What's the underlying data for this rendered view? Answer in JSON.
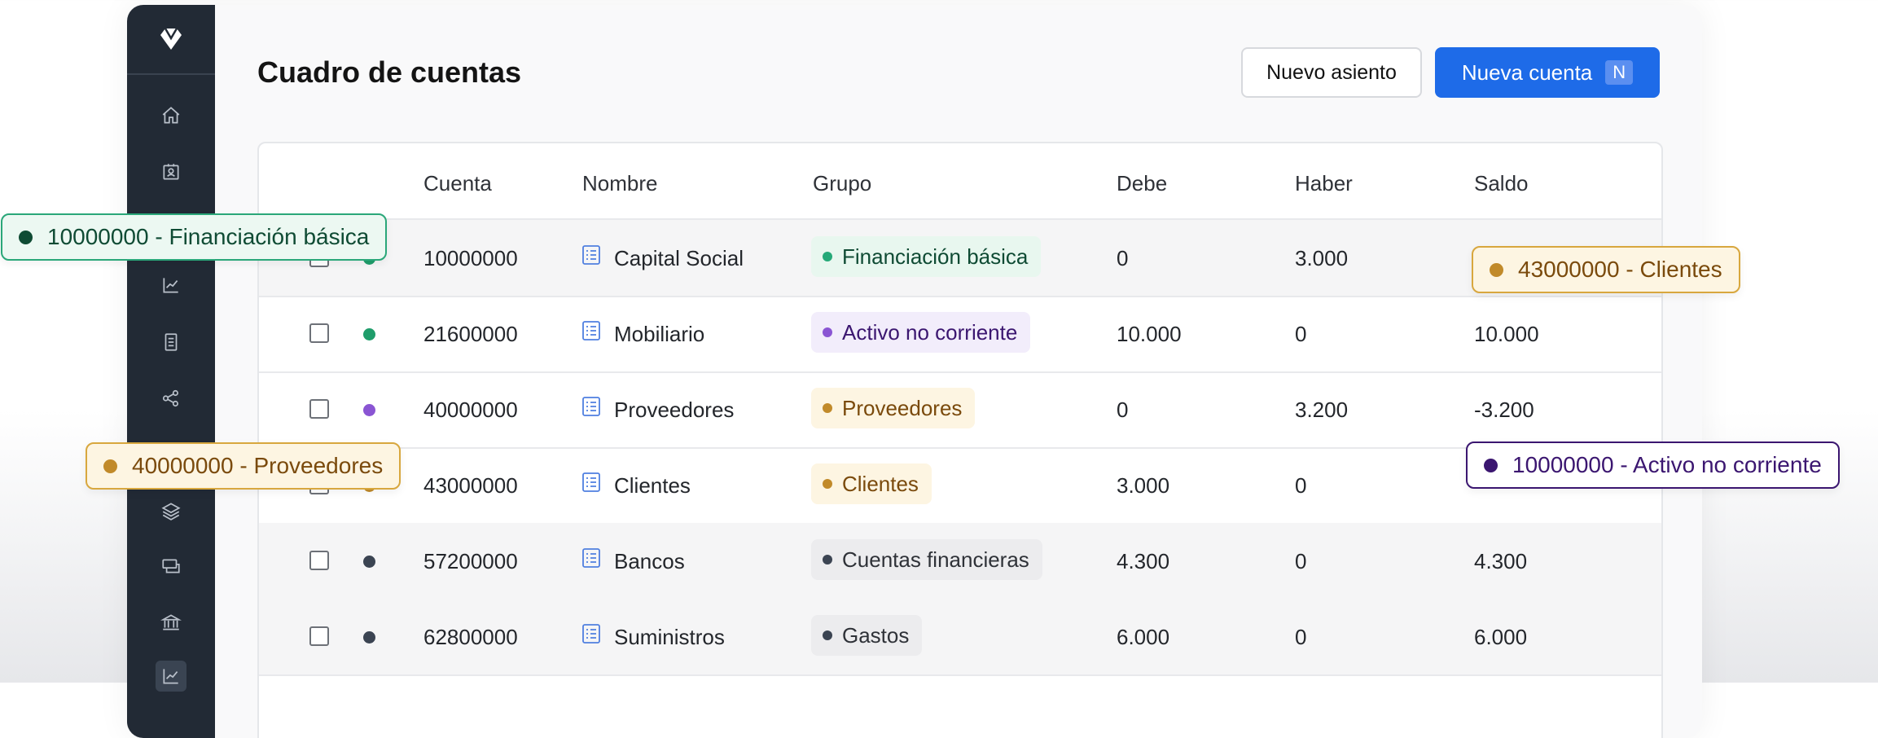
{
  "page": {
    "title": "Cuadro de cuentas"
  },
  "toolbar": {
    "secondary_label": "Nuevo asiento",
    "primary_label": "Nueva cuenta",
    "primary_shortcut": "N"
  },
  "sidebar": {
    "icons": [
      "home-icon",
      "contacts-icon",
      "reports-icon",
      "ledger-icon",
      "share-icon",
      "layers-icon",
      "payments-icon",
      "bank-icon",
      "analytics-icon"
    ],
    "active": "analytics-icon"
  },
  "table": {
    "columns": [
      "Cuenta",
      "Nombre",
      "Grupo",
      "Debe",
      "Haber",
      "Saldo"
    ],
    "rows": [
      {
        "cuenta": "10000000",
        "nombre": "Capital Social",
        "grupo": "Financiación básica",
        "debe": "0",
        "haber": "3.000",
        "saldo": "",
        "dot": "#1f9d6b",
        "pill_bg": "#e8f7ef",
        "pill_fg": "#0f4b34",
        "pill_dot": "#25a978"
      },
      {
        "cuenta": "21600000",
        "nombre": "Mobiliario",
        "grupo": "Activo no corriente",
        "debe": "10.000",
        "haber": "0",
        "saldo": "10.000",
        "dot": "#1f9d6b",
        "pill_bg": "#f2edfb",
        "pill_fg": "#3b1670",
        "pill_dot": "#8a55d3"
      },
      {
        "cuenta": "40000000",
        "nombre": "Proveedores",
        "grupo": "Proveedores",
        "debe": "0",
        "haber": "3.200",
        "saldo": "-3.200",
        "dot": "#8a55d3",
        "pill_bg": "#fdf5e2",
        "pill_fg": "#7a4a0c",
        "pill_dot": "#c18a2a"
      },
      {
        "cuenta": "43000000",
        "nombre": "Clientes",
        "grupo": "Clientes",
        "debe": "3.000",
        "haber": "0",
        "saldo": "",
        "dot": "#c18a2a",
        "pill_bg": "#fdf5e2",
        "pill_fg": "#7a4a0c",
        "pill_dot": "#c18a2a"
      },
      {
        "cuenta": "57200000",
        "nombre": "Bancos",
        "grupo": "Cuentas financieras",
        "debe": "4.300",
        "haber": "0",
        "saldo": "4.300",
        "dot": "#3b4452",
        "pill_bg": "#ececee",
        "pill_fg": "#2f3238",
        "pill_dot": "#3b4452"
      },
      {
        "cuenta": "62800000",
        "nombre": "Suministros",
        "grupo": "Gastos",
        "debe": "6.000",
        "haber": "0",
        "saldo": "6.000",
        "dot": "#3b4452",
        "pill_bg": "#ececee",
        "pill_fg": "#2f3238",
        "pill_dot": "#3b4452"
      }
    ]
  },
  "tags": {
    "financiacion": {
      "label": "10000000 - Financiación básica",
      "bg": "#ecf8f2",
      "border": "#2aa779",
      "color": "#0f4b34",
      "dot": "#0f4b34"
    },
    "clientes": {
      "label": "43000000 - Clientes",
      "bg": "#fdf5e2",
      "border": "#d8a73e",
      "color": "#7a4a0c",
      "dot": "#c18a2a"
    },
    "proveedores": {
      "label": "40000000 - Proveedores",
      "bg": "#fdf5e2",
      "border": "#d8a73e",
      "color": "#7a4a0c",
      "dot": "#c18a2a"
    },
    "activo": {
      "label": "10000000 - Activo no corriente",
      "bg": "#ffffff",
      "border": "#3b1670",
      "color": "#3b1670",
      "dot": "#3b1670"
    }
  }
}
